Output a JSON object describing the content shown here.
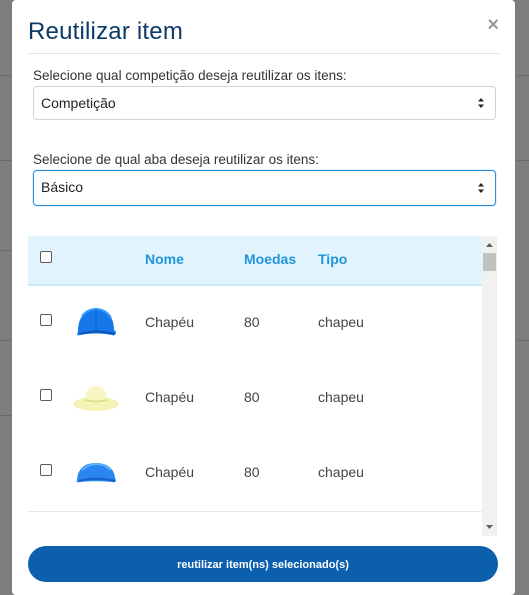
{
  "modal": {
    "title": "Reutilizar item",
    "close_label": "×"
  },
  "competition": {
    "label": "Selecione qual competição deseja reutilizar os itens:",
    "selected": "Competição"
  },
  "tab": {
    "label": "Selecione de qual aba deseja reutilizar os itens:",
    "selected": "Básico"
  },
  "table": {
    "columns": [
      "Nome",
      "Moedas",
      "Tipo"
    ],
    "rows": [
      {
        "name": "Chapéu",
        "coins": "80",
        "type": "chapeu",
        "icon": "blue-cap-icon"
      },
      {
        "name": "Chapéu",
        "coins": "80",
        "type": "chapeu",
        "icon": "yellow-sunhat-icon"
      },
      {
        "name": "Chapéu",
        "coins": "80",
        "type": "chapeu",
        "icon": "blue-cap-icon"
      }
    ]
  },
  "footer": {
    "submit_label": "reutilizar item(ns) selecionado(s)"
  },
  "colors": {
    "title": "#0b3a66",
    "header_bg": "#e1f3fd",
    "header_text": "#2196d8",
    "primary": "#0b5fad"
  }
}
